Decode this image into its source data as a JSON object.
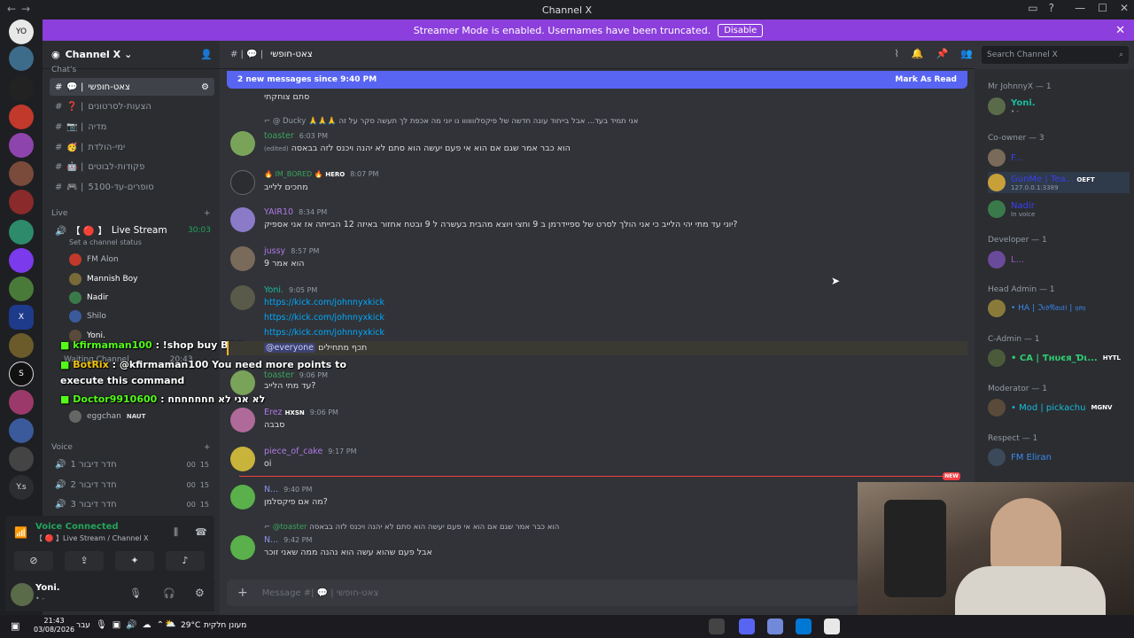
{
  "window": {
    "title": "Channel X"
  },
  "banner": {
    "text": "Streamer Mode is enabled. Usernames have been truncated.",
    "disable_label": "Disable"
  },
  "server": {
    "name": "Channel X"
  },
  "channels": {
    "category_text": "Chat's",
    "items": [
      {
        "label": "צאט-חופשי",
        "prefix": "💬 |"
      },
      {
        "label": "הצעות-לסרטונים",
        "prefix": "❓ |"
      },
      {
        "label": "מדיה",
        "prefix": "📷 |"
      },
      {
        "label": "ימי-הולדת",
        "prefix": "🥳 |"
      },
      {
        "label": "פקודות-לבוטים",
        "prefix": "🤖 |"
      },
      {
        "label": "סופרים-עד-5100",
        "prefix": "🎮 |"
      }
    ],
    "category_live": "Live",
    "live_stream": {
      "label": "Live Stream",
      "prefix": "【 🔴 】",
      "timer": "30:03",
      "status": "Set a channel status"
    },
    "voice_users": [
      "FM Alon",
      "Mannish Boy",
      "Nadir",
      "Shilo",
      "Yoni.",
      "eggchan"
    ],
    "eggchan_tag": "NAUT",
    "waiting_channel": "Waiting Channel",
    "waiting_timer": "20:43",
    "category_voice": "Voice",
    "voice_channels": [
      {
        "label": "חדר דיבור 1",
        "a": "00",
        "b": "15"
      },
      {
        "label": "חדר דיבור 2",
        "a": "00",
        "b": "15"
      },
      {
        "label": "חדר דיבור 3",
        "a": "00",
        "b": "15"
      }
    ]
  },
  "overlay_chat": {
    "line1_user": "kfirmaman100",
    "line1_text": ": !shop buy BOO",
    "line2_user": "BotRix",
    "line2_text": ": @kfirmaman100 You need more points to",
    "line3_text": "execute this command",
    "line4_user": "Doctor9910600",
    "line4_text": ": לא אני לא חחחחחחח"
  },
  "voice_panel": {
    "status": "Voice Connected",
    "channel": "【 🔴 】Live Stream / Channel X"
  },
  "user_panel": {
    "name": "Yoni.",
    "sub": "• -"
  },
  "chat_header": {
    "channel": "צאט-חופשי",
    "prefix": "#  |  💬 |",
    "search_placeholder": "Search Channel X"
  },
  "new_messages": {
    "text": "2 new messages since 9:40 PM",
    "mark_read": "Mark As Read"
  },
  "messages": [
    {
      "text": "סתם צוחקתי"
    },
    {
      "reply_user": "@ Ducky",
      "reply_text": "🙏🙏🙏 אני תמיד בעד... אבל בייחוד עונה חדשה של פיקסלווווווו נו יוני מה אכפת לך תעשה סקר על זה",
      "user": "toaster",
      "time": "6:03 PM",
      "edited": "(edited)",
      "text": "הוא כבר אמר שגם אם הוא אי פעם יעשה הוא סתם לא יהנה ויכנס לזה בבאסה"
    },
    {
      "user": "🔥 IM_BORED 🔥",
      "tag": "HERO",
      "time": "8:07 PM",
      "text": "מחכים ללייב"
    },
    {
      "user": "YAIR10",
      "time": "8:34 PM",
      "text": "יוני עד מתי יהי הלייב כי אני הולך לסרט של ספיידרמן ב 9 וחצי ויוצא מהבית בעשרה ל 9 ובטח אחזור באיזה 12 הבייתה אז אני אספיק?"
    },
    {
      "user": "jussy",
      "time": "8:57 PM",
      "text": "הוא אמר 9"
    },
    {
      "user": "Yoni.",
      "time": "9:05 PM",
      "links": [
        "https://kick.com/johnnyxkick",
        "https://kick.com/johnnyxkick",
        "https://kick.com/johnnyxkick"
      ],
      "mention": "@everyone",
      "mention_text": "תכף מתחילים"
    },
    {
      "user": "toaster",
      "time": "9:06 PM",
      "text": "עד מתי הלייב?"
    },
    {
      "user": "Erez",
      "tag": "HXSN",
      "time": "9:06 PM",
      "text": "סבבה"
    },
    {
      "user": "piece_of_cake",
      "time": "9:17 PM",
      "text": "oi"
    },
    {
      "user": "N...",
      "time": "9:40 PM",
      "text": "מה אם פיקסלמן?"
    },
    {
      "reply_user": "@toaster",
      "reply_text": "הוא כבר אמר שגם אם הוא אי פעם יעשה הוא סתם לא יהנה ויכנס לזה בבאסה",
      "user": "N...",
      "time": "9:42 PM",
      "text": "אבל פעם שהוא עשה הוא נהנה ממה שאני זוכר"
    }
  ],
  "new_tag": "NEW",
  "composer": {
    "placeholder": "Message #| 💬 | צאט-חופשי"
  },
  "members": {
    "groups": [
      {
        "title": "Mr JohnnyX — 1",
        "members": [
          {
            "name": "Yoni.",
            "sub": "• -"
          }
        ]
      },
      {
        "title": "Co-owner — 3",
        "members": [
          {
            "name": "F..."
          },
          {
            "name": "GunMe | Tea...",
            "tag": "OEFT",
            "sub": "127.0.0.1:3389"
          },
          {
            "name": "Nadir",
            "sub": "In voice"
          }
        ]
      },
      {
        "title": "Developer — 1",
        "members": [
          {
            "name": "L..."
          }
        ]
      },
      {
        "title": "Head Admin — 1",
        "members": [
          {
            "name": "• HA | ℑ𝔢𝔡𝔑𝔞𝔲𝔱𝔦 | 𝔶𝔬𝔶"
          }
        ]
      },
      {
        "title": "C-Admin — 1",
        "members": [
          {
            "name": "• CA | Ƭнυєя_Ɗι...",
            "tag": "HYTL"
          }
        ]
      },
      {
        "title": "Moderator — 1",
        "members": [
          {
            "name": "• Mod | pickachu",
            "tag": "MGNV"
          }
        ]
      },
      {
        "title": "Respect — 1",
        "members": [
          {
            "name": "FM Eliran"
          }
        ]
      }
    ]
  },
  "taskbar": {
    "time": "21:43",
    "date": "03/08/2026",
    "lang": "עבר",
    "weather": "29°C",
    "weather_text": "מעונן חלקית"
  },
  "colors": {
    "accent": "#5865f2",
    "banner": "#8c3fdc",
    "new": "#f23f43",
    "green": "#23a55a"
  }
}
